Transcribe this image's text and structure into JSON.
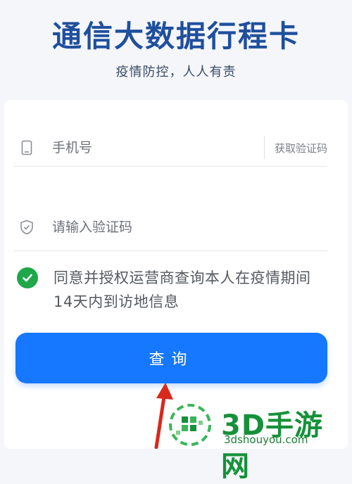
{
  "header": {
    "title": "通信大数据行程卡",
    "subtitle": "疫情防控，人人有责"
  },
  "form": {
    "phone_placeholder": "手机号",
    "get_code_label": "获取验证码",
    "code_placeholder": "请输入验证码",
    "consent_text": "同意并授权运营商查询本人在疫情期间14天内到访地信息",
    "consent_checked": true,
    "submit_label": "查询"
  },
  "watermark": {
    "brand": "3D手游网",
    "url": "3dshouyou.com"
  },
  "colors": {
    "title": "#1f4f9d",
    "primary_button": "#1677ff",
    "check": "#1ea84a",
    "arrow": "#d9281c",
    "watermark": "#16913a"
  },
  "icons": {
    "phone": "phone-icon",
    "shield": "shield-icon",
    "check": "check-icon",
    "arrow": "arrow-annotation-icon",
    "logo": "watermark-logo"
  }
}
